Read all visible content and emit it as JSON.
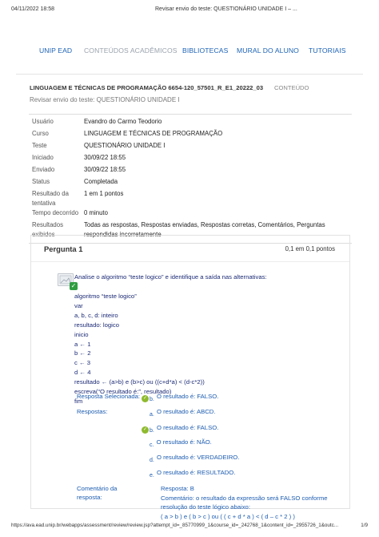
{
  "print": {
    "datetime": "04/11/2022 18:58",
    "doc_title": "Revisar envio do teste: QUESTIONÁRIO UNIDADE I – ...",
    "url": "https://ava.ead.unip.br/webapps/assessment/review/review.jsp?attempt_id=_85770999_1&course_id=_242768_1&content_id=_2955726_1&outc...",
    "page": "1/9"
  },
  "nav": {
    "items": [
      {
        "label": "UNIP EAD"
      },
      {
        "label": "CONTEÚDOS ACADÊMICOS"
      },
      {
        "label": "BIBLIOTECAS"
      },
      {
        "label": "MURAL DO ALUNO"
      },
      {
        "label": "TUTORIAIS"
      }
    ]
  },
  "course": {
    "title": "LINGUAGEM E TÉCNICAS DE PROGRAMAÇÃO 6654-120_57501_R_E1_20222_03",
    "content_label": "CONTEÚDO",
    "subtitle": "Revisar envio do teste: QUESTIONÁRIO UNIDADE I"
  },
  "info": [
    {
      "label": "Usuário",
      "value": "Evandro do Carmo Teodorio"
    },
    {
      "label": "Curso",
      "value": "LINGUAGEM E TÉCNICAS DE PROGRAMAÇÃO"
    },
    {
      "label": "Teste",
      "value": "QUESTIONÁRIO UNIDADE I"
    },
    {
      "label": "Iniciado",
      "value": "30/09/22 18:55"
    },
    {
      "label": "Enviado",
      "value": "30/09/22 18:55"
    },
    {
      "label": "Status",
      "value": "Completada"
    },
    {
      "label": "Resultado da tentativa",
      "value": "1 em 1 pontos"
    },
    {
      "label": "Tempo decorrido",
      "value": "0 minuto"
    },
    {
      "label": "Resultados exibidos",
      "value": "Todas as respostas, Respostas enviadas, Respostas corretas, Comentários, Perguntas respondidas incorretamente"
    }
  ],
  "question": {
    "title": "Pergunta 1",
    "points": "0,1 em 0,1 pontos",
    "statement": "Analise o algoritmo “teste logico” e identifique a saída nas alternativas:",
    "code": [
      "algoritmo “teste logico”",
      "var",
      "a, b, c, d: inteiro",
      "resultado: logico",
      "inicio",
      "a ← 1",
      "b ← 2",
      "c ← 3",
      "d ← 4",
      "resultado ← (a>b) e (b>c) ou ((c+d*a) < (d-c*2))",
      "escreva(“O resultado é:”, resultado)",
      "fim"
    ],
    "selected_label": "Resposta Selecionada:",
    "selected_letter": "b.",
    "selected_text": "O resultado é: FALSO.",
    "answers_label": "Respostas:",
    "options": [
      {
        "letter": "a.",
        "text": "O resultado é: ABCD."
      },
      {
        "letter": "b.",
        "text": "O resultado é: FALSO."
      },
      {
        "letter": "c.",
        "text": "O resultado é: NÃO."
      },
      {
        "letter": "d.",
        "text": "O resultado é: VERDADEIRO."
      },
      {
        "letter": "e.",
        "text": "O resultado é: RESULTADO."
      }
    ],
    "comment_label_1": "Comentário da",
    "comment_label_2": "resposta:",
    "comment_answer": "Resposta: B",
    "comment_text": "Comentário: o resultado da expressão será FALSO conforme resolução do teste lógico abaixo:",
    "comment_expr": "( a > b ) e ( b > c ) ou ( ( c + d * a ) < ( d – c * 2 ) )"
  },
  "colors": {
    "nav_active": "#1c63b6",
    "nav_inactive": "#9aa3ad",
    "answer_blue": "#1c5cb0",
    "question_navy": "#1b2a75",
    "correct_green": "#8fba2d"
  }
}
